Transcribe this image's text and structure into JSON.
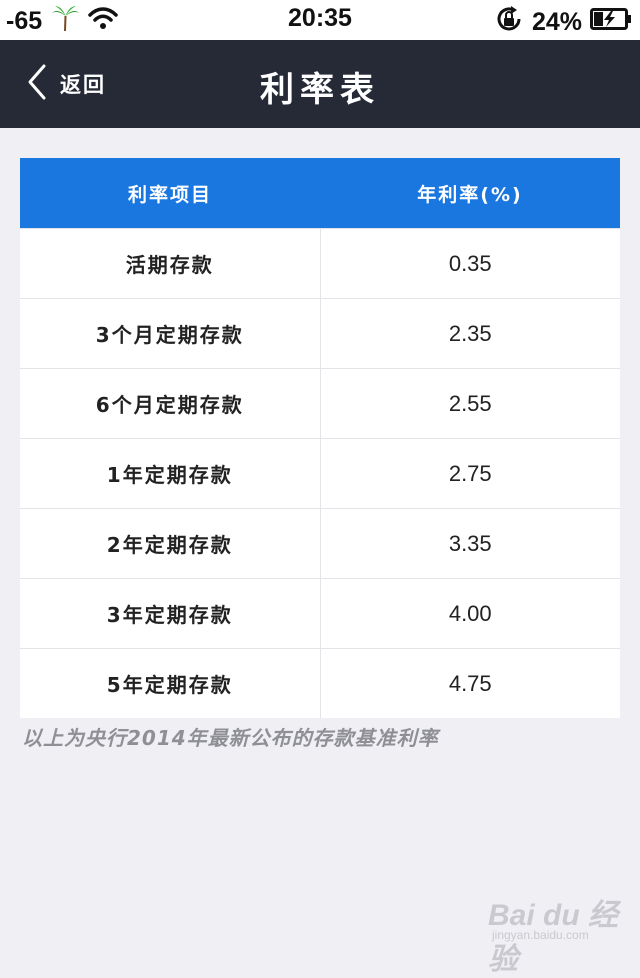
{
  "status_bar": {
    "signal": "-65",
    "time": "20:35",
    "battery_percent": "24%",
    "battery_level": 0.24
  },
  "nav": {
    "back_label": "返回",
    "title": "利率表"
  },
  "table": {
    "headers": [
      "利率项目",
      "年利率(%)"
    ],
    "rows": [
      {
        "item": "活期存款",
        "rate": "0.35"
      },
      {
        "item": "3个月定期存款",
        "rate": "2.35"
      },
      {
        "item": "6个月定期存款",
        "rate": "2.55"
      },
      {
        "item": "1年定期存款",
        "rate": "2.75"
      },
      {
        "item": "2年定期存款",
        "rate": "3.35"
      },
      {
        "item": "3年定期存款",
        "rate": "4.00"
      },
      {
        "item": "5年定期存款",
        "rate": "4.75"
      }
    ]
  },
  "footnote": "以上为央行2014年最新公布的存款基准利率",
  "watermark": {
    "main": "Bai du 经验",
    "sub": "jingyan.baidu.com"
  },
  "colors": {
    "nav_background": "#252a36",
    "table_header": "#1a77df",
    "page_background": "#efeff4"
  },
  "icons": [
    "palm-tree-icon",
    "wifi-icon",
    "rotation-lock-icon",
    "battery-charging-icon",
    "chevron-left-icon"
  ]
}
